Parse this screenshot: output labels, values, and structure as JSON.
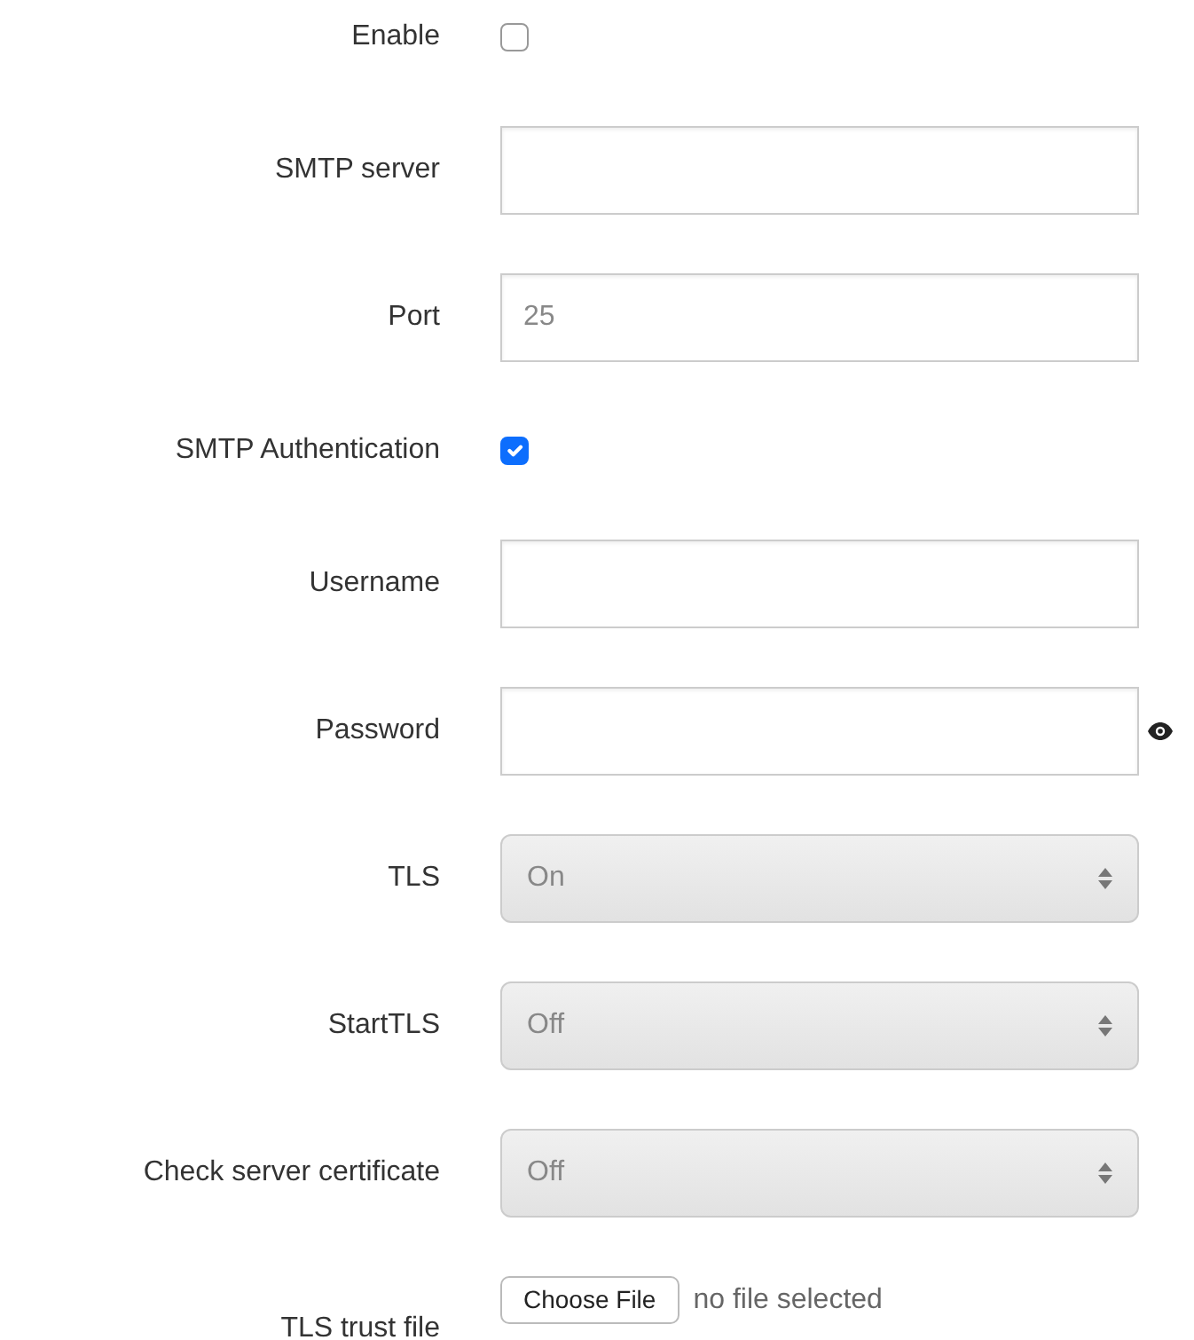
{
  "fields": [
    {
      "kind": "checkbox",
      "label": "Enable",
      "checked": false
    },
    {
      "kind": "text",
      "label": "SMTP server"
    },
    {
      "kind": "text",
      "label": "Port",
      "placeholder": "25"
    },
    {
      "kind": "checkbox",
      "label": "SMTP Authentication",
      "checked": true
    },
    {
      "kind": "text",
      "label": "Username"
    },
    {
      "kind": "password",
      "label": "Password"
    },
    {
      "kind": "select",
      "label": "TLS",
      "value": "On"
    },
    {
      "kind": "select",
      "label": "StartTLS",
      "value": "Off"
    },
    {
      "kind": "select",
      "label": "Check server certificate",
      "value": "Off"
    },
    {
      "kind": "file",
      "label": "TLS trust file",
      "button": "Choose File",
      "status": "no file selected"
    }
  ]
}
